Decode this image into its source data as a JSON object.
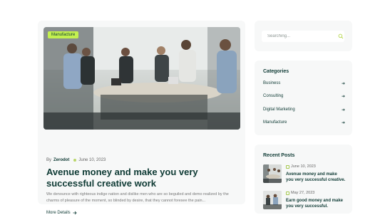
{
  "post": {
    "category": "Manufacture",
    "author_prefix": "By",
    "author": "Zerodot",
    "date": "June 10, 2023",
    "title": "Avenue money and make you very successful creative work",
    "excerpt": "We denounce with righteous indige nation and dislike men who are so beguiled and demo realized by the charms of pleasure of the moment, so blinded by desire, that they cannot foresee the pain...",
    "more_label": "More Details",
    "more_icon": "arrow-right"
  },
  "search": {
    "placeholder": "Searching...",
    "icon": "search-icon"
  },
  "categories": {
    "title": "Categories",
    "items": [
      {
        "label": "Business"
      },
      {
        "label": "Consulting"
      },
      {
        "label": "Digital Marketing"
      },
      {
        "label": "Manufacture"
      }
    ]
  },
  "recent_posts": {
    "title": "Recent Posts",
    "items": [
      {
        "date": "June 10, 2023",
        "title": "Avenue money and make you very successful creative."
      },
      {
        "date": "May 27, 2023",
        "title": "Earn good money and make you very successful."
      }
    ]
  },
  "colors": {
    "accent": "#c3f04f",
    "heading": "#0e3a34",
    "card_bg": "#f7f8f8"
  }
}
